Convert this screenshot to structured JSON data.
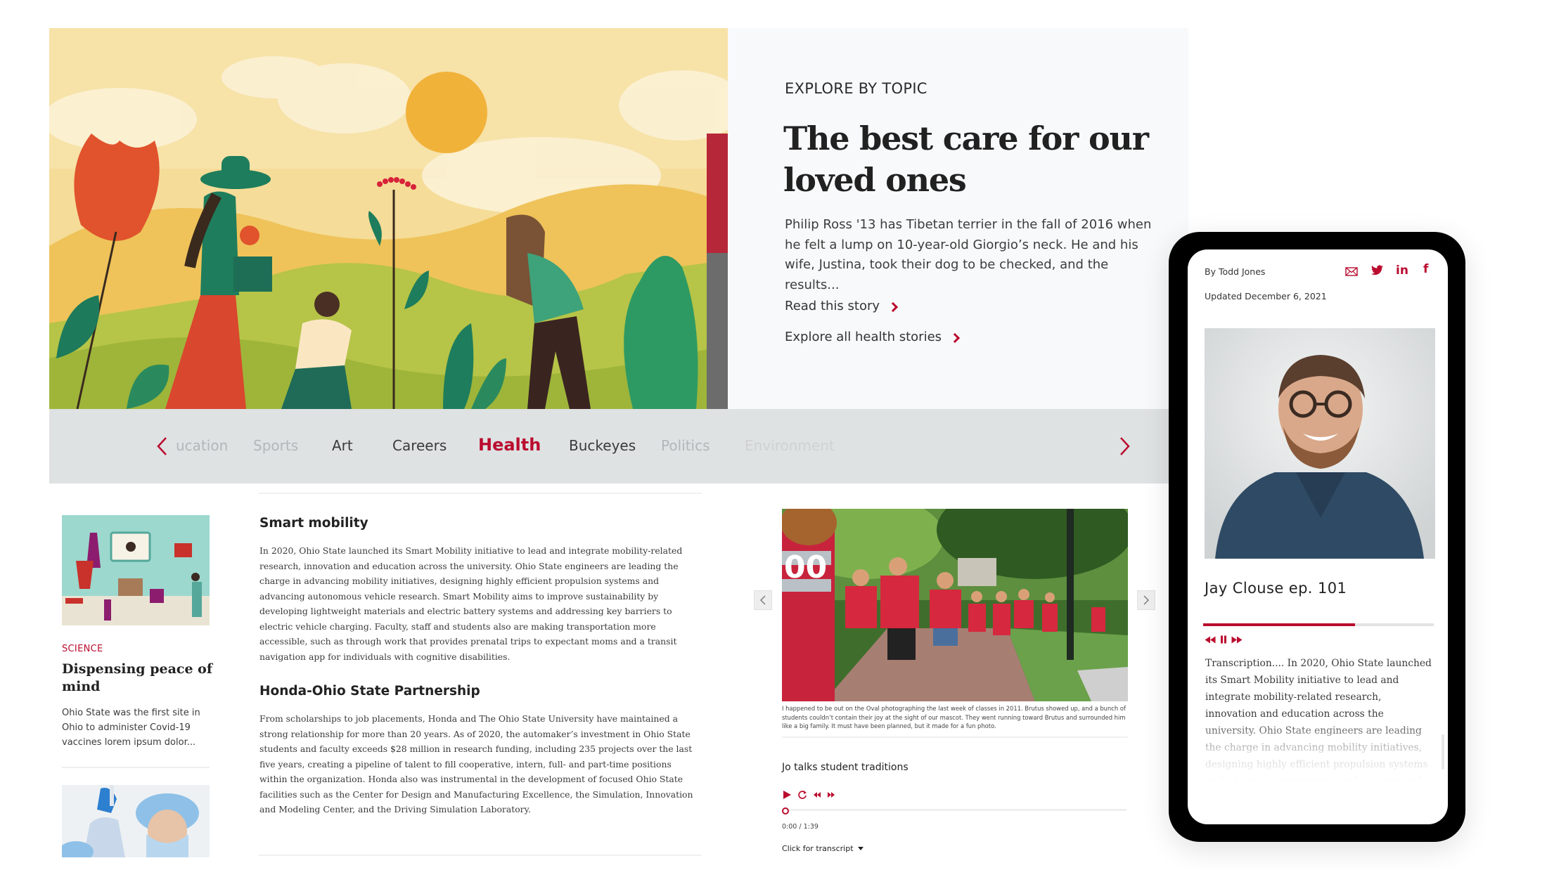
{
  "hero": {
    "image_alt": "Illustration of people gardening under a sun with flowers and hills",
    "eyebrow": "EXPLORE BY TOPIC",
    "title": "The best care for our loved ones",
    "description": "Philip Ross '13 has Tibetan terrier in the fall of 2016 when he felt a lump on 10-year-old Giorgio’s neck. He and his wife, Justina, took their dog to be checked, and the results...",
    "links": [
      {
        "label": "Read this story",
        "icon": "chevron-right-icon"
      },
      {
        "label": "Explore all health stories",
        "icon": "chevron-right-icon"
      }
    ]
  },
  "topic_nav": {
    "prev_icon": "chevron-left-icon",
    "next_icon": "chevron-right-icon",
    "topics": [
      {
        "label": "Education",
        "visible_text": "ucation",
        "state": "faded"
      },
      {
        "label": "Sports",
        "state": "faded"
      },
      {
        "label": "Art",
        "state": "normal"
      },
      {
        "label": "Careers",
        "state": "normal"
      },
      {
        "label": "Health",
        "state": "active"
      },
      {
        "label": "Buckeyes",
        "state": "normal"
      },
      {
        "label": "Politics",
        "state": "faded"
      },
      {
        "label": "Environment",
        "state": "very-faded"
      }
    ]
  },
  "story_card": {
    "image_alt": "Illustration of diverse people with laptops and buildings on teal background",
    "kicker": "SCIENCE",
    "title": "Dispensing peace of mind",
    "description": "Ohio State was the first site in Ohio to administer Covid-19 vaccines lorem ipsum dolor...",
    "next_image_alt": "Healthcare worker in protective gear holding a test tube"
  },
  "article": {
    "sections": [
      {
        "heading": "Smart mobility",
        "body": "In 2020, Ohio State launched its Smart Mobility initiative to lead and integrate mobility-related research, innovation and education across the university. Ohio State engineers are leading the charge in advancing mobility initiatives, designing highly efficient propulsion systems and advancing autonomous vehicle research. Smart Mobility aims to improve sustainability by developing lightweight materials and electric battery systems and addressing key barriers to electric vehicle charging. Faculty, staff and students also are making transportation more accessible, such as through work that provides prenatal trips to expectant moms and a transit navigation app for individuals with cognitive disabilities."
      },
      {
        "heading": "Honda-Ohio State Partnership",
        "body": "From scholarships to job placements, Honda and The Ohio State University have maintained a strong relationship for more than 20 years. As of 2020, the automaker’s investment in Ohio State students and faculty exceeds $28 million in research funding, including 235 projects over the last five years, creating a pipeline of talent to fill cooperative, intern, full- and part-time positions within the organization. Honda also was instrumental in the development of focused Ohio State facilities such as the Center for Design and Manufacturing Excellence, the Simulation, Innovation and Modeling Center, and the Driving Simulation Laboratory."
      }
    ]
  },
  "gallery": {
    "image_alt": "Students in red shirts running toward Brutus the mascot on the Oval",
    "prev_icon": "chevron-left-icon",
    "next_icon": "chevron-right-icon",
    "caption": "I happened to be out on the Oval photographing the last week of classes in 2011. Brutus showed up, and a bunch of students couldn’t contain their joy at the sight of our mascot. They went running toward Brutus and surrounded him like a big family. It must have been planned, but it made for a fun photo."
  },
  "audio": {
    "title": "Jo talks student traditions",
    "controls": [
      "play-icon",
      "replay-icon",
      "rewind-icon",
      "fast-forward-icon"
    ],
    "time": "0:00 / 1:39",
    "progress": 0,
    "transcript_toggle": "Click for transcript"
  },
  "phone": {
    "byline": "By Todd Jones",
    "updated": "Updated December 6, 2021",
    "share_icons": [
      "email-icon",
      "twitter-icon",
      "linkedin-icon",
      "facebook-icon"
    ],
    "linkedin_text": "in",
    "facebook_text": "f",
    "portrait_alt": "Smiling bearded man with glasses in denim shirt",
    "episode_title": "Jay Clouse ep. 101",
    "progress_percent": 66,
    "controls": [
      "rewind-icon",
      "pause-icon",
      "fast-forward-icon"
    ],
    "transcript": "Transcription.... In 2020, Ohio State launched its Smart Mobility initiative to lead and integrate mobility-related research, innovation and education across the university. Ohio State engineers are leading the charge in advancing mobility initiatives, designing highly efficient propulsion systems and advancing autonomous vehicle research."
  },
  "colors": {
    "accent": "#ba0c2f",
    "nav_background": "#dfe2e3",
    "hero_panel_background": "#f8f9fa",
    "phone_frame": "#000000"
  }
}
